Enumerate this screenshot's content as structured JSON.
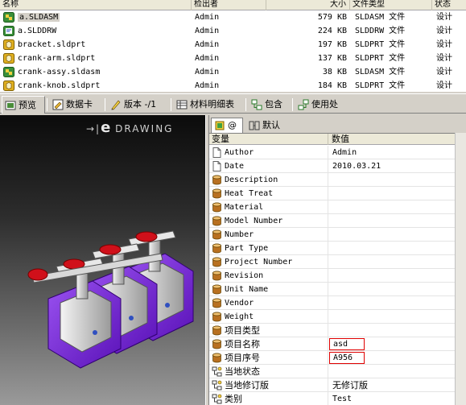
{
  "file_list": {
    "columns": [
      "名称",
      "检出者",
      "大小",
      "文件类型",
      "状态"
    ],
    "rows": [
      {
        "name": "a.SLDASM",
        "checked_out_by": "Admin",
        "size": "579 KB",
        "type": "SLDASM 文件",
        "state": "设计",
        "icon": "assembly-icon",
        "selected": true
      },
      {
        "name": "a.SLDDRW",
        "checked_out_by": "Admin",
        "size": "224 KB",
        "type": "SLDDRW 文件",
        "state": "设计",
        "icon": "drawing-icon",
        "selected": false
      },
      {
        "name": "bracket.sldprt",
        "checked_out_by": "Admin",
        "size": "197 KB",
        "type": "SLDPRT 文件",
        "state": "设计",
        "icon": "part-icon",
        "selected": false
      },
      {
        "name": "crank-arm.sldprt",
        "checked_out_by": "Admin",
        "size": "137 KB",
        "type": "SLDPRT 文件",
        "state": "设计",
        "icon": "part-icon",
        "selected": false
      },
      {
        "name": "crank-assy.sldasm",
        "checked_out_by": "Admin",
        "size": "38 KB",
        "type": "SLDASM 文件",
        "state": "设计",
        "icon": "assembly-icon",
        "selected": false
      },
      {
        "name": "crank-knob.sldprt",
        "checked_out_by": "Admin",
        "size": "184 KB",
        "type": "SLDPRT 文件",
        "state": "设计",
        "icon": "part-icon",
        "selected": false
      }
    ]
  },
  "tabs": [
    {
      "label": "预览",
      "icon": "preview-icon",
      "active": true
    },
    {
      "label": "数据卡",
      "icon": "datacard-icon",
      "active": false
    },
    {
      "label": "版本 -/1",
      "icon": "version-icon",
      "active": false
    },
    {
      "label": "材料明细表",
      "icon": "bom-icon",
      "active": false
    },
    {
      "label": "包含",
      "icon": "contains-icon",
      "active": false
    },
    {
      "label": "使用处",
      "icon": "where-used-icon",
      "active": false
    }
  ],
  "preview": {
    "logo_arrow": "→|",
    "logo_e": "e",
    "logo_text": "DRAWING"
  },
  "config_tabs": [
    {
      "label": "@",
      "icon": "config-icon",
      "active": true
    },
    {
      "label": "默认",
      "icon": "config-default-icon",
      "active": false
    }
  ],
  "properties": {
    "columns": [
      "变量",
      "数值"
    ],
    "rows": [
      {
        "name": "Author",
        "value": "Admin",
        "icon": "document-icon",
        "highlight": false
      },
      {
        "name": "Date",
        "value": "2010.03.21",
        "icon": "document-icon",
        "highlight": false
      },
      {
        "name": "Description",
        "value": "",
        "icon": "database-icon",
        "highlight": false
      },
      {
        "name": "Heat Treat",
        "value": "",
        "icon": "database-icon",
        "highlight": false
      },
      {
        "name": "Material",
        "value": "",
        "icon": "database-icon",
        "highlight": false
      },
      {
        "name": "Model Number",
        "value": "",
        "icon": "database-icon",
        "highlight": false
      },
      {
        "name": "Number",
        "value": "",
        "icon": "database-icon",
        "highlight": false
      },
      {
        "name": "Part Type",
        "value": "",
        "icon": "database-icon",
        "highlight": false
      },
      {
        "name": "Project Number",
        "value": "",
        "icon": "database-icon",
        "highlight": false
      },
      {
        "name": "Revision",
        "value": "",
        "icon": "database-icon",
        "highlight": false
      },
      {
        "name": "Unit Name",
        "value": "",
        "icon": "database-icon",
        "highlight": false
      },
      {
        "name": "Vendor",
        "value": "",
        "icon": "database-icon",
        "highlight": false
      },
      {
        "name": "Weight",
        "value": "",
        "icon": "database-icon",
        "highlight": false
      },
      {
        "name": "项目类型",
        "value": "",
        "icon": "database-icon",
        "highlight": false
      },
      {
        "name": "项目名称",
        "value": "asd",
        "icon": "database-icon",
        "highlight": true
      },
      {
        "name": "项目序号",
        "value": "A956",
        "icon": "database-icon",
        "highlight": true
      },
      {
        "name": "当地状态",
        "value": "",
        "icon": "workflow-icon",
        "highlight": false
      },
      {
        "name": "当地修订版",
        "value": "无修订版",
        "icon": "workflow-icon",
        "highlight": false
      },
      {
        "name": "类别",
        "value": "Test",
        "icon": "workflow-icon",
        "highlight": false
      }
    ]
  },
  "colors": {
    "highlight_border": "#e00000",
    "body_purple": "#7b2cd8",
    "handle_red": "#d0101a"
  }
}
